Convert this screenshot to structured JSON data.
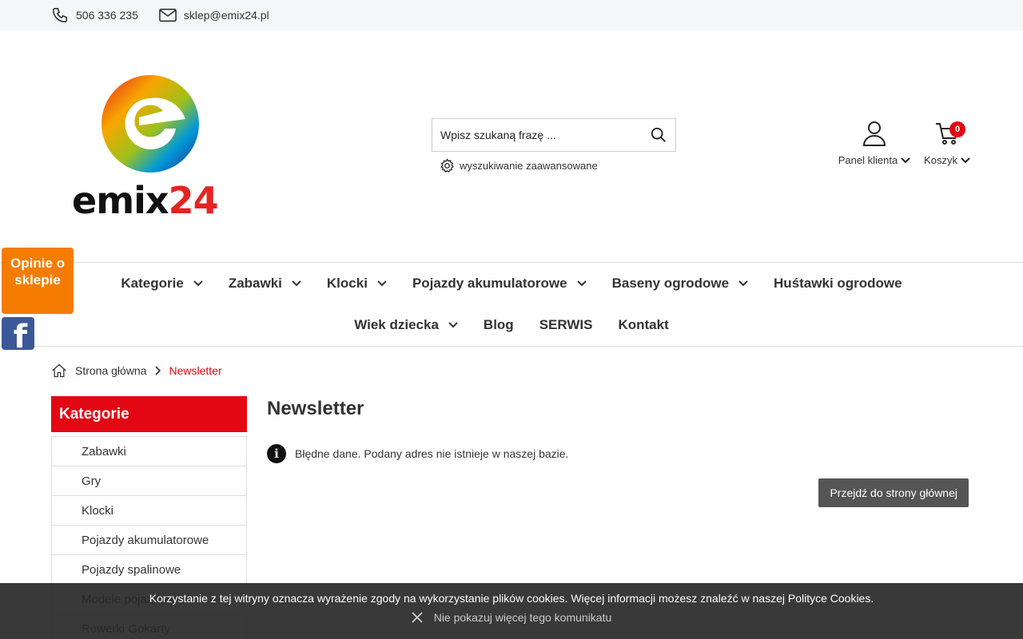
{
  "topbar": {
    "phone": "506 336 235",
    "email": "sklep@emix24.pl"
  },
  "logo": {
    "text_black": "emix",
    "text_red": "24"
  },
  "search": {
    "placeholder": "Wpisz szukaną frazę ...",
    "advanced_label": "wyszukiwanie zaawansowane"
  },
  "header": {
    "account_label": "Panel klienta",
    "cart_label": "Koszyk",
    "cart_count": "0"
  },
  "nav": {
    "row1": [
      {
        "label": "Kategorie",
        "dropdown": true
      },
      {
        "label": "Zabawki",
        "dropdown": true
      },
      {
        "label": "Klocki",
        "dropdown": true
      },
      {
        "label": "Pojazdy akumulatorowe",
        "dropdown": true
      },
      {
        "label": "Baseny ogrodowe",
        "dropdown": true
      },
      {
        "label": "Huśtawki ogrodowe",
        "dropdown": false
      }
    ],
    "row2": [
      {
        "label": "Wiek dziecka",
        "dropdown": true
      },
      {
        "label": "Blog",
        "dropdown": false
      },
      {
        "label": "SERWIS",
        "dropdown": false
      },
      {
        "label": "Kontakt",
        "dropdown": false
      }
    ]
  },
  "side_widgets": {
    "opinie": "Opinie o sklepie",
    "facebook": "f"
  },
  "breadcrumb": {
    "home": "Strona główna",
    "current": "Newsletter"
  },
  "sidebar": {
    "title": "Kategorie",
    "items": [
      "Zabawki",
      "Gry",
      "Klocki",
      "Pojazdy akumulatorowe",
      "Pojazdy spalinowe",
      "Modele pojazdów",
      "Rowerki Gokarty"
    ]
  },
  "main": {
    "title": "Newsletter",
    "message": "Błędne dane. Podany adres nie istnieje w naszej bazie.",
    "back_button": "Przejdź do strony głównej"
  },
  "cookie": {
    "text": "Korzystanie z tej witryny oznacza wyrażenie zgody na wykorzystanie plików cookies. Więcej informacji możesz znaleźć w naszej Polityce Cookies.",
    "dismiss": "Nie pokazuj więcej tego komunikatu"
  },
  "colors": {
    "accent_red": "#e30613",
    "opinie_orange": "#f57c00",
    "facebook_blue": "#3b5998"
  }
}
